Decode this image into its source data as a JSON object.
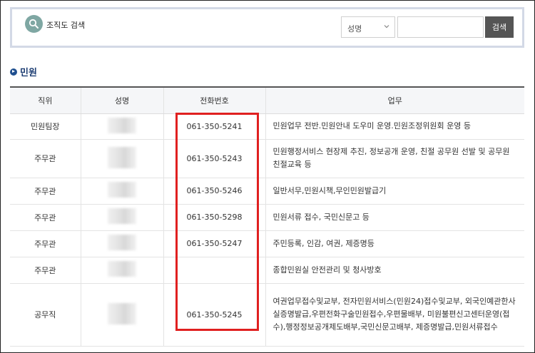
{
  "search": {
    "title": "조직도 검색",
    "select_value": "성명",
    "input_value": "",
    "button_label": "검색"
  },
  "section": {
    "title": "민원"
  },
  "table": {
    "headers": [
      "직위",
      "성명",
      "전화번호",
      "업무"
    ],
    "rows": [
      {
        "position": "민원팀장",
        "phone": "061-350-5241",
        "duty": "민원업무 전반.민원안내 도우미 운영.민원조정위원회 운영 등"
      },
      {
        "position": "주무관",
        "phone": "061-350-5243",
        "duty": "민원행정서비스 현장제 추진, 정보공개 운영, 친절 공무원 선발 및 공무원 친절교육 등"
      },
      {
        "position": "주무관",
        "phone": "061-350-5246",
        "duty": "일반서무,민원시책,무인민원발급기"
      },
      {
        "position": "주무관",
        "phone": "061-350-5298",
        "duty": "민원서류 접수, 국민신문고 등"
      },
      {
        "position": "주무관",
        "phone": "061-350-5247",
        "duty": "주민등록, 인감, 여권, 제증명등"
      },
      {
        "position": "주무관",
        "phone": "",
        "duty": "종합민원실 안전관리 및 청사방호"
      },
      {
        "position": "공무직",
        "phone": "061-350-5245",
        "duty": "여권업무접수및교부, 전자민원서비스(민원24)접수및교부, 외국인예관한사실증명발급,우편전화구술민원접수,우편물배부, 미원불편신고센터운영(접수),행정정보공개제도배부,국민신문고배부, 제증명발급,민원서류접수"
      }
    ]
  },
  "colors": {
    "highlight": "#e02020",
    "accent": "#1f3f74",
    "button": "#555555"
  }
}
